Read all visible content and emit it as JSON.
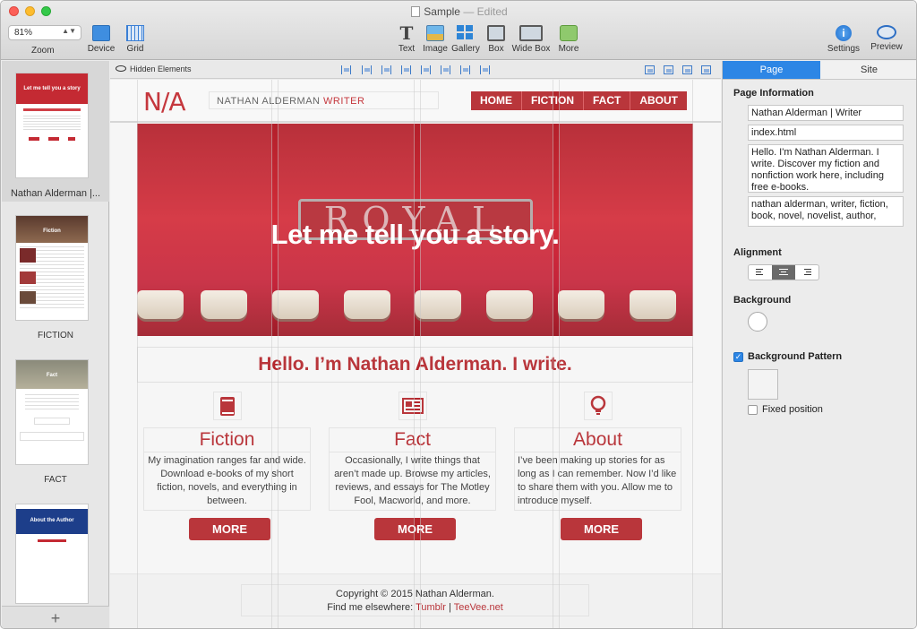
{
  "window": {
    "title": "Sample",
    "status": "Edited",
    "separator": "—"
  },
  "toolbar": {
    "zoom_value": "81%",
    "zoom_label": "Zoom",
    "device_label": "Device",
    "grid_label": "Grid",
    "text_label": "Text",
    "image_label": "Image",
    "gallery_label": "Gallery",
    "box_label": "Box",
    "widebox_label": "Wide Box",
    "more_label": "More",
    "settings_label": "Settings",
    "preview_label": "Preview"
  },
  "pages": {
    "items": [
      {
        "label": "Nathan Alderman |...",
        "thumb_heading": "Let me tell you a story",
        "selected": true
      },
      {
        "label": "FICTION",
        "thumb_heading": "Fiction"
      },
      {
        "label": "FACT",
        "thumb_heading": "Fact"
      },
      {
        "label": "",
        "thumb_heading": "About the Author"
      }
    ],
    "add_label": "+"
  },
  "canvas_bar": {
    "hidden_elements_label": "Hidden Elements"
  },
  "site": {
    "logo": "N/A",
    "name_plain": "NATHAN ALDERMAN ",
    "name_accent": "WRITER",
    "nav": [
      "HOME",
      "FICTION",
      "FACT",
      "ABOUT"
    ],
    "hero_plate": "ROYAL",
    "hero_tagline": "Let me tell you a story.",
    "hello": "Hello. I’m Nathan Alderman. I write.",
    "features": [
      {
        "title": "Fiction",
        "icon": "book-icon",
        "body": "My imagination ranges far and wide. Download e-books of my short fiction, novels, and everything in between.",
        "button": "MORE"
      },
      {
        "title": "Fact",
        "icon": "newspaper-icon",
        "body": "Occasionally, I write things that aren’t made up. Browse my articles, reviews, and essays for The Motley Fool, Macworld, and more.",
        "button": "MORE"
      },
      {
        "title": "About",
        "icon": "lightbulb-icon",
        "body": "I’ve been making up stories for as long as I can remember. Now I’d like to share them with you. Allow me to introduce myself.",
        "button": "MORE"
      }
    ],
    "footer_copyright": "Copyright © 2015 Nathan Alderman.",
    "footer_elsewhere": "Find me elsewhere: ",
    "footer_link1": "Tumblr",
    "footer_sep": " | ",
    "footer_link2": "TeeVee.net"
  },
  "inspector": {
    "tabs": [
      {
        "label": "Page",
        "active": true
      },
      {
        "label": "Site",
        "active": false
      }
    ],
    "page_info_heading": "Page Information",
    "page_title": "Nathan Alderman | Writer",
    "filename": "index.html",
    "description": "Hello. I'm Nathan Alderman. I write. Discover my fiction and nonfiction work here, including free e-books.",
    "keywords": "nathan alderman, writer, fiction, book, novel, novelist, author,",
    "alignment_heading": "Alignment",
    "alignment_selected": "center",
    "background_heading": "Background",
    "background_color": "#ffffff",
    "bg_pattern_label": "Background Pattern",
    "bg_pattern_checked": true,
    "fixed_position_label": "Fixed position",
    "fixed_position_checked": false
  },
  "colors": {
    "brand_red": "#b3252b",
    "accent_blue": "#2d86e5"
  }
}
